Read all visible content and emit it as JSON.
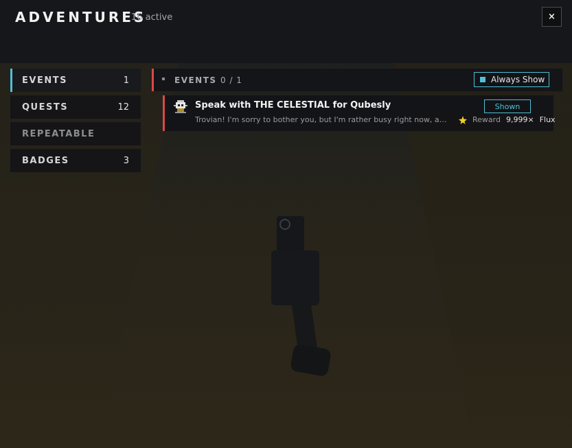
{
  "header": {
    "title": "ADVENTURES",
    "active_count": "16 active",
    "close_label": "×"
  },
  "sidebar": {
    "items": [
      {
        "label": "EVENTS",
        "count": "1"
      },
      {
        "label": "QUESTS",
        "count": "12"
      },
      {
        "label": "REPEATABLE",
        "count": ""
      },
      {
        "label": "BADGES",
        "count": "3"
      }
    ]
  },
  "section": {
    "label": "EVENTS",
    "progress": "0 / 1",
    "always_show_label": "Always Show"
  },
  "quest": {
    "title": "Speak with THE CELESTIAL for Qubesly",
    "description": "Trovian! I'm sorry to bother you, but I'm rather busy right now, and I need someone to speak with The Celestial",
    "shown_label": "Shown",
    "reward_label": "Reward",
    "reward_qty": "9,999×",
    "reward_item": "Flux"
  },
  "colors": {
    "accent": "#4fc0d6",
    "event_marker": "#d94a4a"
  }
}
